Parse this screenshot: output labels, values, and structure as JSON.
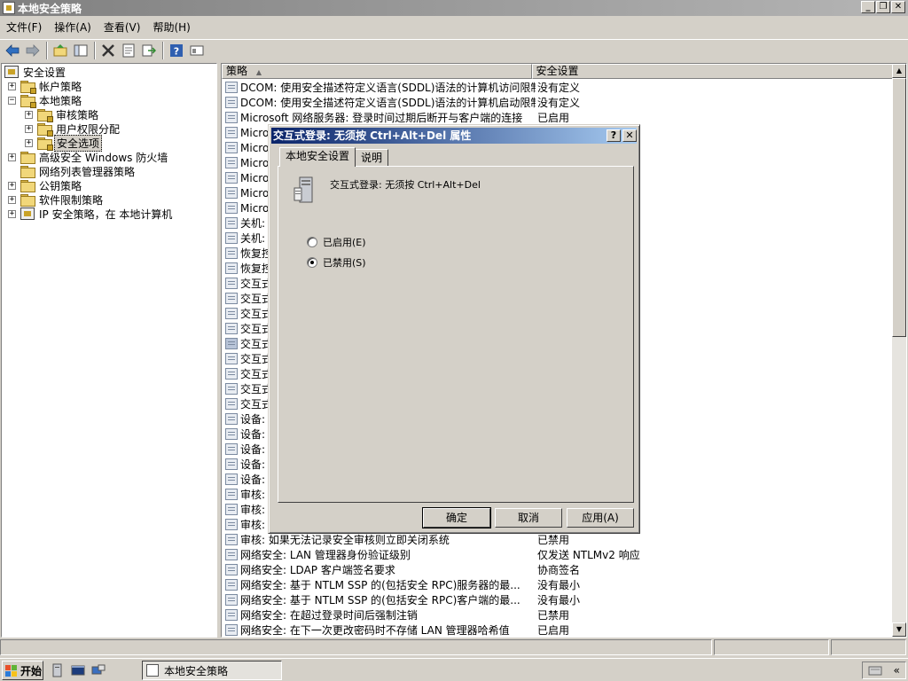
{
  "window": {
    "title": "本地安全策略",
    "controls": [
      "_",
      "❐",
      "✕"
    ]
  },
  "menu": [
    "文件(F)",
    "操作(A)",
    "查看(V)",
    "帮助(H)"
  ],
  "toolbar": {
    "icons": [
      "back-arrow-icon",
      "forward-arrow-icon",
      "up-folder-icon",
      "show-hide-tree-icon",
      "delete-icon",
      "properties-icon",
      "export-list-icon",
      "help-icon",
      "mmc-console-icon"
    ]
  },
  "tree": {
    "items": [
      {
        "label": "安全设置",
        "level": 0,
        "expander": "",
        "icon": "shield"
      },
      {
        "label": "帐户策略",
        "level": 1,
        "expander": "+",
        "icon": "folder-lock"
      },
      {
        "label": "本地策略",
        "level": 1,
        "expander": "−",
        "icon": "folder-lock"
      },
      {
        "label": "审核策略",
        "level": 2,
        "expander": "+",
        "icon": "folder-lock"
      },
      {
        "label": "用户权限分配",
        "level": 2,
        "expander": "+",
        "icon": "folder-lock"
      },
      {
        "label": "安全选项",
        "level": 2,
        "expander": "+",
        "icon": "folder-lock",
        "selected": true
      },
      {
        "label": "高级安全 Windows 防火墙",
        "level": 1,
        "expander": "+",
        "icon": "folder"
      },
      {
        "label": "网络列表管理器策略",
        "level": 1,
        "expander": "",
        "icon": "folder"
      },
      {
        "label": "公钥策略",
        "level": 1,
        "expander": "+",
        "icon": "folder"
      },
      {
        "label": "软件限制策略",
        "level": 1,
        "expander": "+",
        "icon": "folder"
      },
      {
        "label": "IP 安全策略，在 本地计算机",
        "level": 1,
        "expander": "+",
        "icon": "shield"
      }
    ]
  },
  "list": {
    "columns": [
      "策略",
      "安全设置"
    ],
    "sort_indicator": "▲",
    "rows": [
      {
        "name": "DCOM: 使用安全描述符定义语言(SDDL)语法的计算机访问限制",
        "value": "没有定义"
      },
      {
        "name": "DCOM: 使用安全描述符定义语言(SDDL)语法的计算机启动限制",
        "value": "没有定义"
      },
      {
        "name": "Microsoft 网络服务器: 登录时间过期后断开与客户端的连接",
        "value": "已启用"
      },
      {
        "name": "Micro",
        "value": ""
      },
      {
        "name": "Micro",
        "value": ""
      },
      {
        "name": "Micro",
        "value": ""
      },
      {
        "name": "Micro",
        "value": ""
      },
      {
        "name": "Micro",
        "value": ""
      },
      {
        "name": "Micro",
        "value": ""
      },
      {
        "name": "关机:",
        "value": ""
      },
      {
        "name": "关机:",
        "value": ""
      },
      {
        "name": "恢复控",
        "value": ""
      },
      {
        "name": "恢复控",
        "value": ""
      },
      {
        "name": "交互式",
        "value": ""
      },
      {
        "name": "交互式",
        "value": ""
      },
      {
        "name": "交互式",
        "value": ""
      },
      {
        "name": "交互式",
        "value": ""
      },
      {
        "name": "交互式",
        "value": "",
        "selected": true
      },
      {
        "name": "交互式",
        "value": ""
      },
      {
        "name": "交互式",
        "value": ""
      },
      {
        "name": "交互式",
        "value": ""
      },
      {
        "name": "交互式",
        "value": ""
      },
      {
        "name": "设备:",
        "value": ""
      },
      {
        "name": "设备:",
        "value": ""
      },
      {
        "name": "设备:",
        "value": ""
      },
      {
        "name": "设备:",
        "value": ""
      },
      {
        "name": "设备:",
        "value": ""
      },
      {
        "name": "审核:",
        "value": ""
      },
      {
        "name": "审核:",
        "value": ""
      },
      {
        "name": "审核:",
        "value": ""
      },
      {
        "name": "审核: 如果无法记录安全审核则立即关闭系统",
        "value": "已禁用"
      },
      {
        "name": "网络安全: LAN 管理器身份验证级别",
        "value": "仅发送 NTLMv2 响应"
      },
      {
        "name": "网络安全: LDAP 客户端签名要求",
        "value": "协商签名"
      },
      {
        "name": "网络安全: 基于 NTLM SSP 的(包括安全 RPC)服务器的最...",
        "value": "没有最小"
      },
      {
        "name": "网络安全: 基于 NTLM SSP 的(包括安全 RPC)客户端的最...",
        "value": "没有最小"
      },
      {
        "name": "网络安全: 在超过登录时间后强制注销",
        "value": "已禁用"
      },
      {
        "name": "网络安全: 在下一次更改密码时不存储 LAN 管理器哈希值",
        "value": "已启用"
      }
    ]
  },
  "dialog": {
    "title": "交互式登录: 无须按 Ctrl+Alt+Del 属性",
    "help_ctl": "?",
    "close_ctl": "✕",
    "tabs": [
      "本地安全设置",
      "说明"
    ],
    "policy_name": "交互式登录: 无须按 Ctrl+Alt+Del",
    "options": [
      {
        "label": "已启用(E)",
        "checked": false
      },
      {
        "label": "已禁用(S)",
        "checked": true
      }
    ],
    "buttons": {
      "ok": "确定",
      "cancel": "取消",
      "apply": "应用(A)"
    }
  },
  "taskbar": {
    "start_label": "开始",
    "task_label": "本地安全策略",
    "tray_chevron": "«"
  }
}
